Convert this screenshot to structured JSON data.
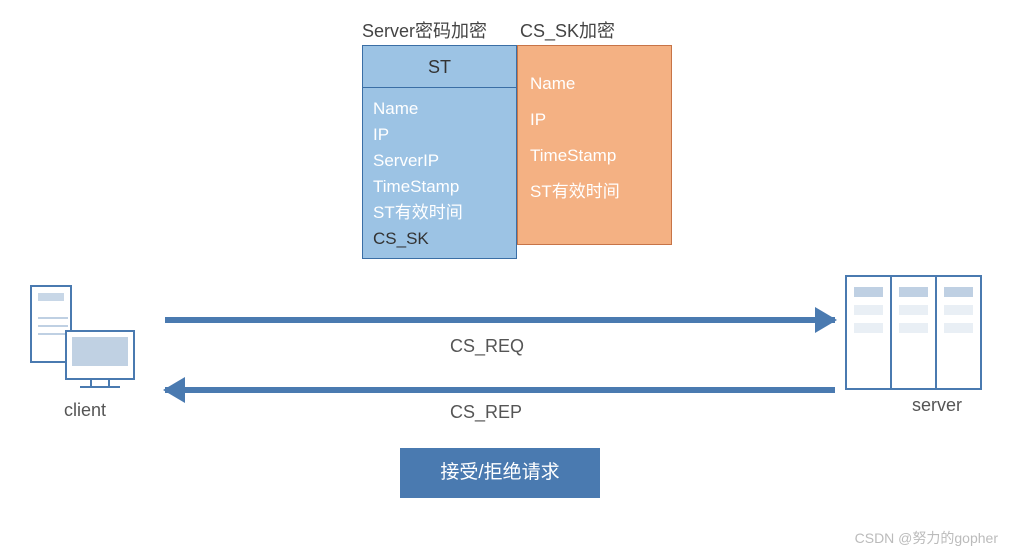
{
  "left_box": {
    "title": "Server密码加密",
    "header": "ST",
    "fields": [
      "Name",
      "IP",
      "ServerIP",
      "TimeStamp",
      "ST有效时间",
      "CS_SK"
    ]
  },
  "right_box": {
    "title": "CS_SK加密",
    "fields": [
      "Name",
      "IP",
      "TimeStamp",
      "ST有效时间"
    ]
  },
  "client_label": "client",
  "server_label": "server",
  "arrow_req": "CS_REQ",
  "arrow_rep": "CS_REP",
  "accept_label": "接受/拒绝请求",
  "watermark": "CSDN @努力的gopher"
}
